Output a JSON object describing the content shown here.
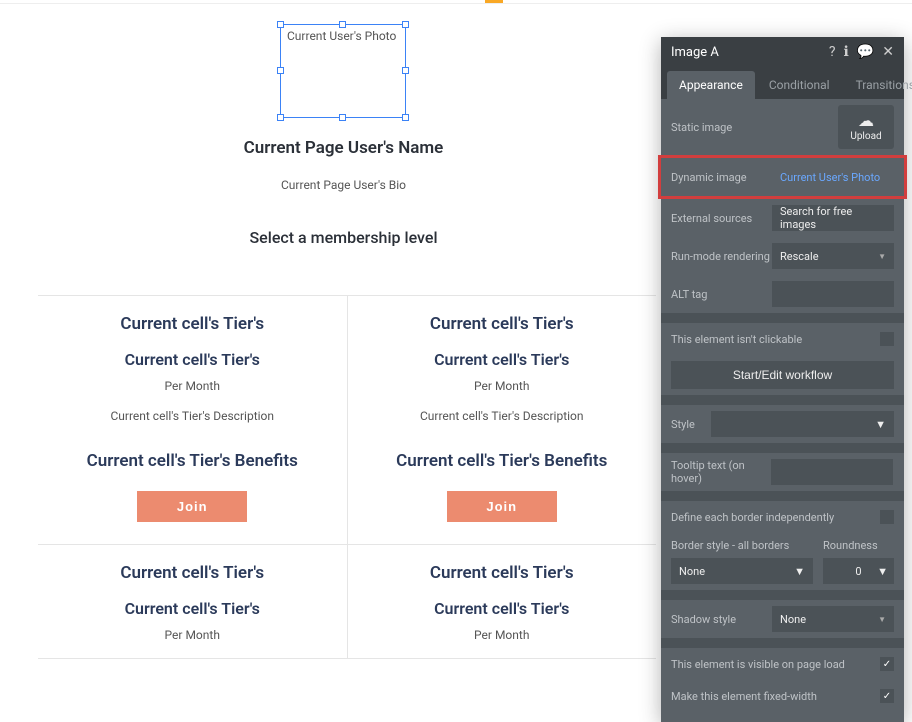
{
  "canvas": {
    "photo_label": "Current User's Photo",
    "user_name": "Current Page User's Name",
    "user_bio": "Current Page User's Bio",
    "section_heading": "Select a membership level",
    "cells": [
      {
        "tier_a": "Current cell's Tier's",
        "tier_b": "Current cell's Tier's",
        "per": "Per Month",
        "desc": "Current cell's Tier's Description",
        "benefits": "Current cell's Tier's Benefits",
        "join": "Join"
      },
      {
        "tier_a": "Current cell's Tier's",
        "tier_b": "Current cell's Tier's",
        "per": "Per Month",
        "desc": "Current cell's Tier's Description",
        "benefits": "Current cell's Tier's Benefits",
        "join": "Join"
      },
      {
        "tier_a": "Current cell's Tier's",
        "tier_b": "Current cell's Tier's",
        "per": "Per Month"
      },
      {
        "tier_a": "Current cell's Tier's",
        "tier_b": "Current cell's Tier's",
        "per": "Per Month"
      }
    ]
  },
  "panel": {
    "title": "Image A",
    "tabs": {
      "appearance": "Appearance",
      "conditional": "Conditional",
      "transitions": "Transitions"
    },
    "props": {
      "static_image_label": "Static image",
      "upload_label": "Upload",
      "dynamic_image_label": "Dynamic image",
      "dynamic_image_value": "Current User's Photo",
      "external_sources_label": "External sources",
      "external_sources_value": "Search for free images",
      "run_mode_label": "Run-mode rendering",
      "run_mode_value": "Rescale",
      "alt_tag_label": "ALT tag",
      "not_clickable_label": "This element isn't clickable",
      "start_workflow_label": "Start/Edit workflow",
      "style_label": "Style",
      "tooltip_label": "Tooltip text (on hover)",
      "border_independent_label": "Define each border independently",
      "border_style_label": "Border style - all borders",
      "border_style_value": "None",
      "roundness_label": "Roundness",
      "roundness_value": "0",
      "shadow_style_label": "Shadow style",
      "shadow_style_value": "None",
      "visible_label": "This element is visible on page load",
      "fixed_width_label": "Make this element fixed-width"
    }
  }
}
